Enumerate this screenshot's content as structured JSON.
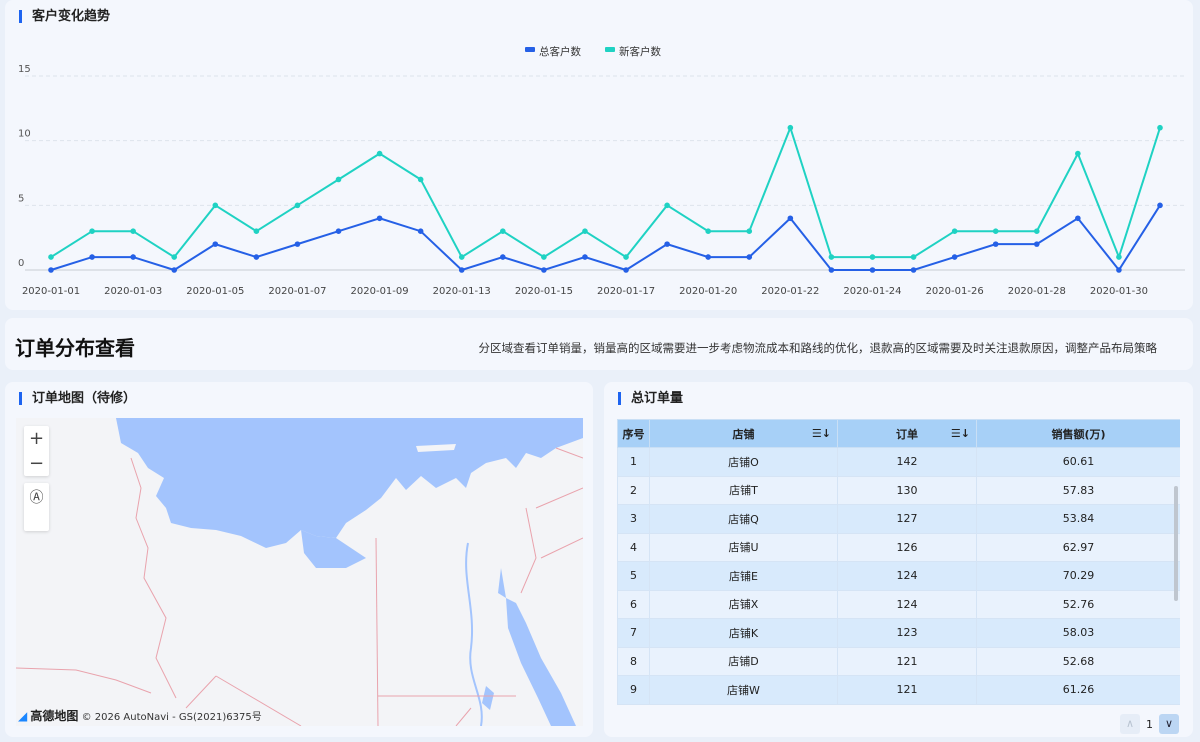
{
  "trend_panel": {
    "title": "客户变化趋势"
  },
  "chart_data": {
    "type": "line",
    "title": "",
    "legend": {
      "placement": "top-center"
    },
    "ylim": [
      0,
      15
    ],
    "yticks": [
      0,
      5,
      10,
      15
    ],
    "grid": true,
    "x": [
      "2020-01-01",
      "2020-01-02",
      "2020-01-03",
      "2020-01-04",
      "2020-01-05",
      "2020-01-06",
      "2020-01-07",
      "2020-01-08",
      "2020-01-09",
      "2020-01-10",
      "2020-01-13",
      "2020-01-14",
      "2020-01-15",
      "2020-01-16",
      "2020-01-17",
      "2020-01-19",
      "2020-01-20",
      "2020-01-21",
      "2020-01-22",
      "2020-01-23",
      "2020-01-24",
      "2020-01-25",
      "2020-01-26",
      "2020-01-27",
      "2020-01-28",
      "2020-01-29",
      "2020-01-30",
      "2020-01-31"
    ],
    "xtick_labels": [
      "2020-01-01",
      "2020-01-03",
      "2020-01-05",
      "2020-01-07",
      "2020-01-09",
      "2020-01-13",
      "2020-01-15",
      "2020-01-17",
      "2020-01-20",
      "2020-01-22",
      "2020-01-24",
      "2020-01-26",
      "2020-01-28",
      "2020-01-30"
    ],
    "series": [
      {
        "name": "总客户数",
        "color": "#2560e6",
        "values": [
          0,
          1,
          1,
          0,
          2,
          1,
          2,
          3,
          4,
          3,
          0,
          1,
          0,
          1,
          0,
          2,
          1,
          1,
          4,
          0,
          0,
          0,
          1,
          2,
          2,
          4,
          0,
          5
        ]
      },
      {
        "name": "新客户数",
        "color": "#1fd2c3",
        "values": [
          1,
          3,
          3,
          1,
          5,
          3,
          5,
          7,
          9,
          7,
          1,
          3,
          1,
          3,
          1,
          5,
          3,
          3,
          11,
          1,
          1,
          1,
          3,
          3,
          3,
          9,
          1,
          11
        ]
      }
    ]
  },
  "banner": {
    "title": "订单分布查看",
    "description": "分区域查看订单销量，销量高的区域需要进一步考虑物流成本和路线的优化，退款高的区域需要及时关注退款原因，调整产品布局策略"
  },
  "map_panel": {
    "title": "订单地图（待修）",
    "zoom_in": "+",
    "zoom_out": "−",
    "compass": "Ⓐ",
    "brand": "高德地图",
    "copyright": "© 2026 AutoNavi - GS(2021)6375号",
    "water_color": "#a3c4fd",
    "land_color": "#f3f4f7",
    "border_color": "#e9a3ad"
  },
  "table_panel": {
    "title": "总订单量",
    "headers": [
      "序号",
      "店铺",
      "订单",
      "销售额(万)"
    ],
    "sort_icon": "☰↓",
    "rows": [
      [
        "1",
        "店铺O",
        "142",
        "60.61"
      ],
      [
        "2",
        "店铺T",
        "130",
        "57.83"
      ],
      [
        "3",
        "店铺Q",
        "127",
        "53.84"
      ],
      [
        "4",
        "店铺U",
        "126",
        "62.97"
      ],
      [
        "5",
        "店铺E",
        "124",
        "70.29"
      ],
      [
        "6",
        "店铺X",
        "124",
        "52.76"
      ],
      [
        "7",
        "店铺K",
        "123",
        "58.03"
      ],
      [
        "8",
        "店铺D",
        "121",
        "52.68"
      ],
      [
        "9",
        "店铺W",
        "121",
        "61.26"
      ]
    ],
    "pager": {
      "prev": "∧",
      "page": "1",
      "next": "∨"
    }
  }
}
